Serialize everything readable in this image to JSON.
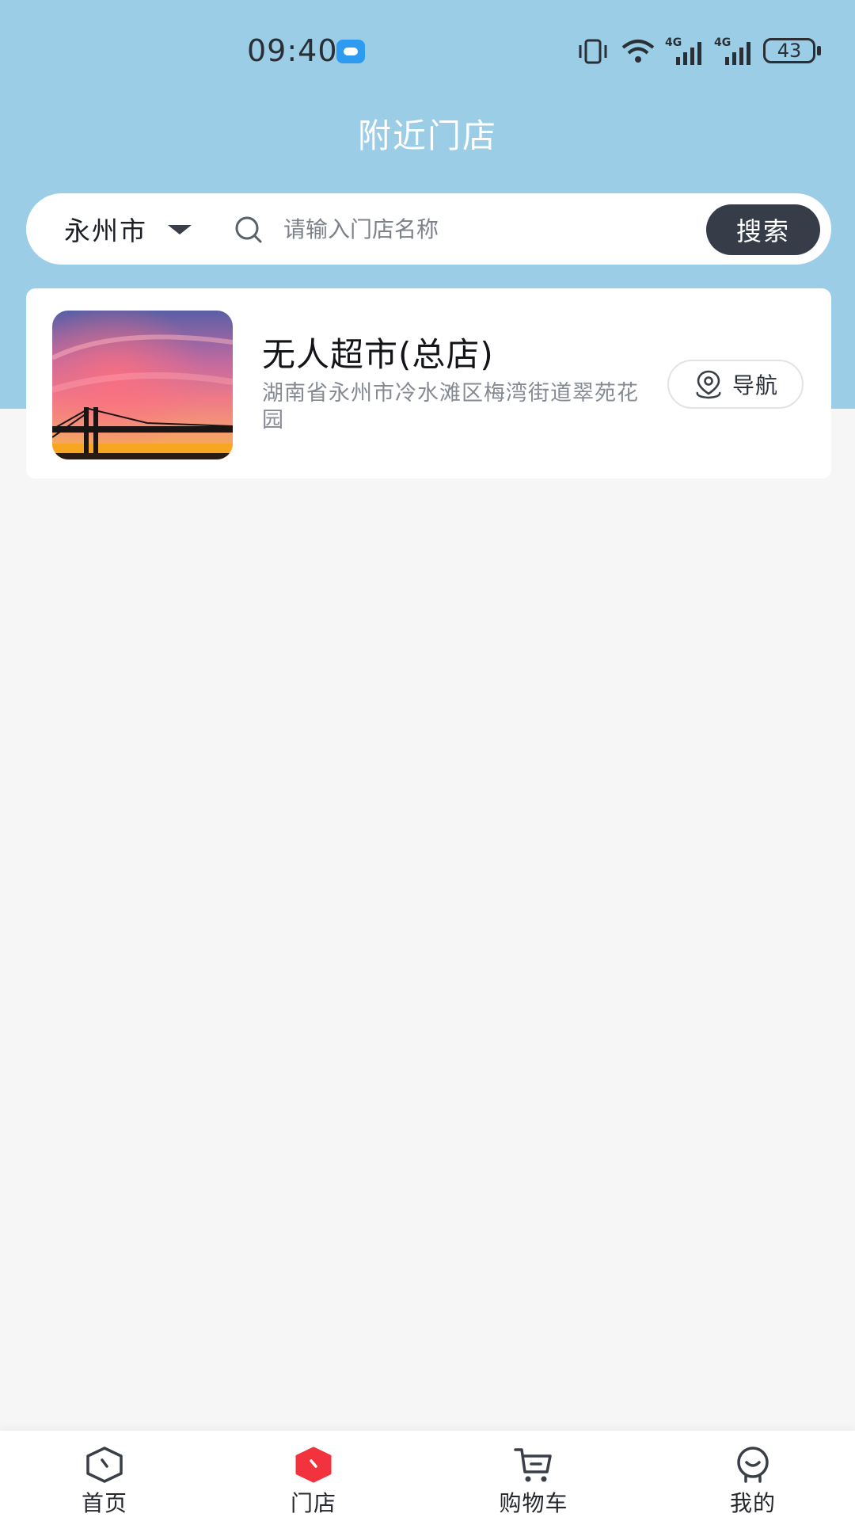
{
  "status_bar": {
    "time": "09:40",
    "network_1": "4G",
    "network_2": "4G",
    "battery": "43"
  },
  "header": {
    "title": "附近门店"
  },
  "search": {
    "city": "永州市",
    "placeholder": "请输入门店名称",
    "button_label": "搜索"
  },
  "stores": [
    {
      "name": "无人超市(总店)",
      "address": "湖南省永州市冷水滩区梅湾街道翠苑花园",
      "nav_label": "导航"
    }
  ],
  "tabs": [
    {
      "label": "首页",
      "icon": "home-icon"
    },
    {
      "label": "门店",
      "icon": "store-icon",
      "active": true
    },
    {
      "label": "购物车",
      "icon": "cart-icon"
    },
    {
      "label": "我的",
      "icon": "profile-icon"
    }
  ],
  "colors": {
    "header_bg": "#9bcde6",
    "page_bg": "#f6f6f7",
    "search_button": "#363c48",
    "active_tab": "#f2323c"
  }
}
